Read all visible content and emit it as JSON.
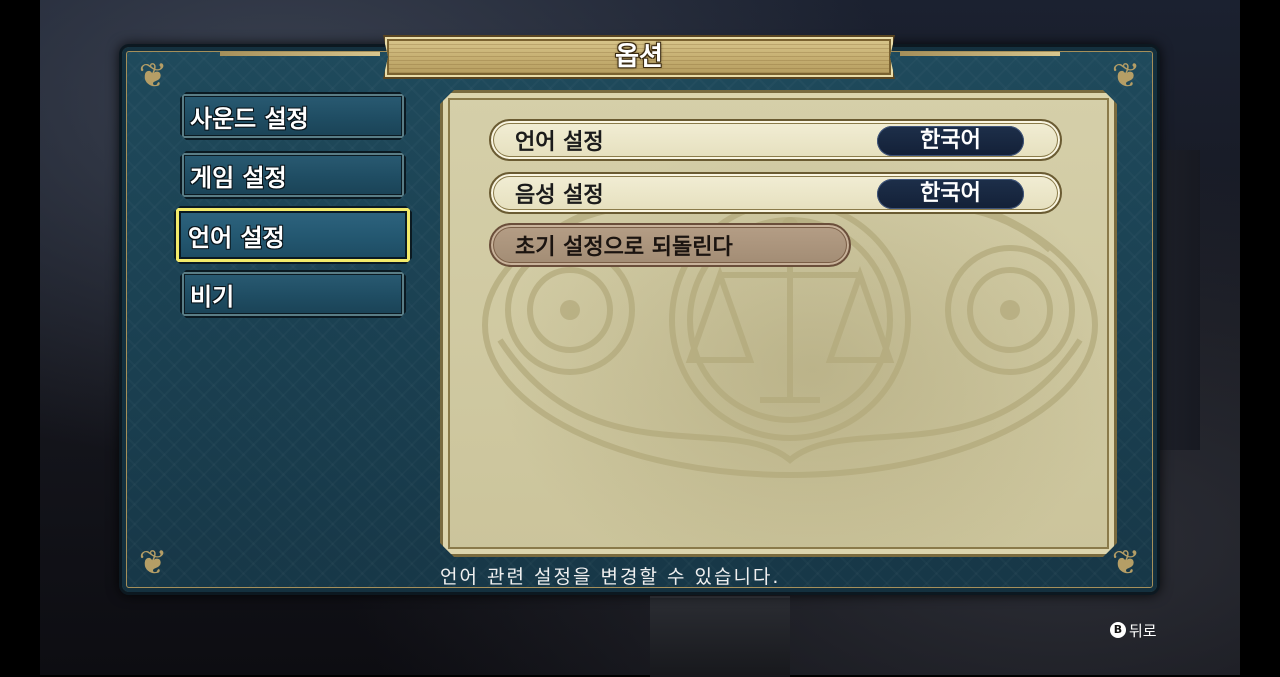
{
  "window": {
    "title": "옵션"
  },
  "sidebar": {
    "items": [
      {
        "label": "사운드 설정",
        "selected": false
      },
      {
        "label": "게임 설정",
        "selected": false
      },
      {
        "label": "언어 설정",
        "selected": true
      },
      {
        "label": "비기",
        "selected": false
      }
    ]
  },
  "settings": {
    "rows": [
      {
        "label": "언어 설정",
        "value": "한국어"
      },
      {
        "label": "음성 설정",
        "value": "한국어"
      }
    ],
    "reset_label": "초기 설정으로 되돌린다"
  },
  "help_text": "언어 관련 설정을 변경할 수 있습니다.",
  "footer": {
    "back_button_icon": "B",
    "back_label": "뒤로"
  },
  "colors": {
    "frame_teal": "#1f4a5c",
    "parchment": "#cbc49b",
    "selection_glow": "#f2ea6a",
    "value_pill": "#1d2f4a",
    "reset_button": "#a28c74",
    "banner_gold": "#c7b073"
  },
  "icons": {
    "corner_ornament": "flourish-icon",
    "emblem": "scales-crest-icon",
    "back_button": "b-button-icon"
  }
}
